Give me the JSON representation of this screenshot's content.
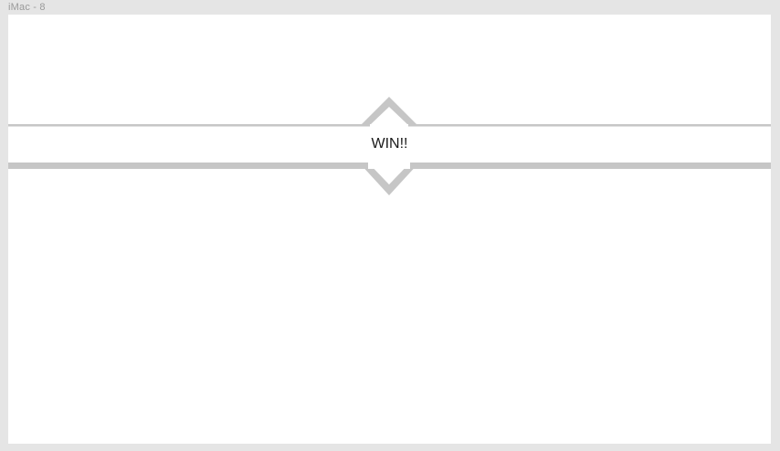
{
  "frame": {
    "label": "iMac - 8"
  },
  "banner": {
    "text": "WIN!!"
  },
  "colors": {
    "page_background": "#e5e5e5",
    "artboard_background": "#ffffff",
    "banner_accent": "#c6c6c6",
    "banner_text": "#1a1a1a",
    "frame_label": "#9a9a9a"
  }
}
